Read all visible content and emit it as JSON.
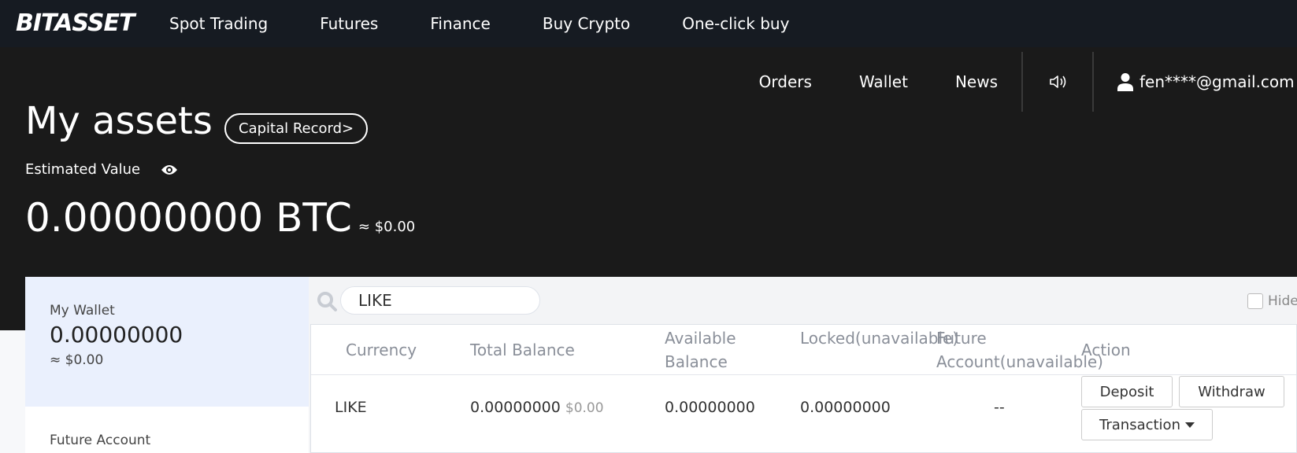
{
  "brand": {
    "logo": "BITASSET"
  },
  "top_nav": [
    "Spot Trading",
    "Futures",
    "Finance",
    "Buy Crypto",
    "One-click buy"
  ],
  "sub_nav": {
    "orders": "Orders",
    "wallet": "Wallet",
    "news": "News",
    "user_email": "fen****@gmail.com"
  },
  "hero": {
    "title": "My assets",
    "capital_record": "Capital Record>",
    "estimated_label": "Estimated Value",
    "estimated_btc": "0.00000000 BTC",
    "estimated_usd": "≈ $0.00"
  },
  "sidebar": {
    "my_wallet": {
      "label": "My Wallet",
      "value": "0.00000000",
      "usd": "≈ $0.00"
    },
    "future_account": {
      "label": "Future Account"
    }
  },
  "search": {
    "value": "LIKE"
  },
  "hide_label": "Hide",
  "table": {
    "headers": {
      "currency": "Currency",
      "total_balance": "Total Balance",
      "available_balance": "Available Balance",
      "locked": "Locked(unavailable)",
      "future_account": "Future Account(unavailable)",
      "action": "Action"
    },
    "rows": [
      {
        "currency": "LIKE",
        "total_balance": "0.00000000",
        "total_usd": "$0.00",
        "available_balance": "0.00000000",
        "locked": "0.00000000",
        "future_account": "--",
        "deposit": "Deposit",
        "withdraw": "Withdraw",
        "transaction": "Transaction"
      }
    ]
  },
  "colors": {
    "topbar": "#161b22",
    "hero_bg": "#1a1a1a",
    "wallet_highlight": "#eaf0fd",
    "panel_bg": "#f3f4f6"
  }
}
